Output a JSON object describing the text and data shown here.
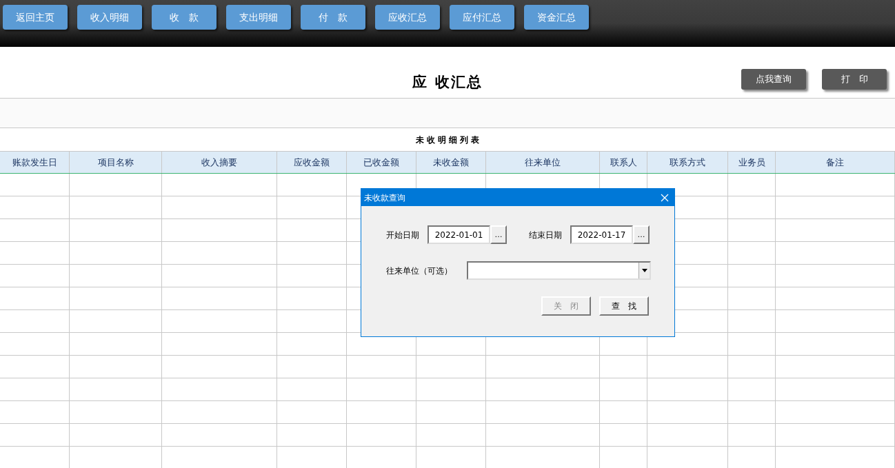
{
  "nav_buttons": [
    "返回主页",
    "收入明细",
    "收　款",
    "支出明细",
    "付　款",
    "应收汇总",
    "应付汇总",
    "资金汇总"
  ],
  "page_title": "应 收汇总",
  "action_buttons": [
    "点我查询",
    "打　印"
  ],
  "table": {
    "title": "未 收 明 细 列 表",
    "columns": [
      "账款发生日",
      "项目名称",
      "收入摘要",
      "应收金额",
      "已收金额",
      "未收金额",
      "往来单位",
      "联系人",
      "联系方式",
      "业务员",
      "备注"
    ]
  },
  "dialog": {
    "title": "未收款查询",
    "start_label": "开始日期",
    "start_value": "2022-01-01",
    "end_label": "结束日期",
    "end_value": "2022-01-17",
    "picker_button": "…",
    "unit_label": "往来单位（可选）",
    "buttons": [
      {
        "label": "关　闭",
        "disabled": true
      },
      {
        "label": "查　找",
        "disabled": false
      }
    ]
  }
}
